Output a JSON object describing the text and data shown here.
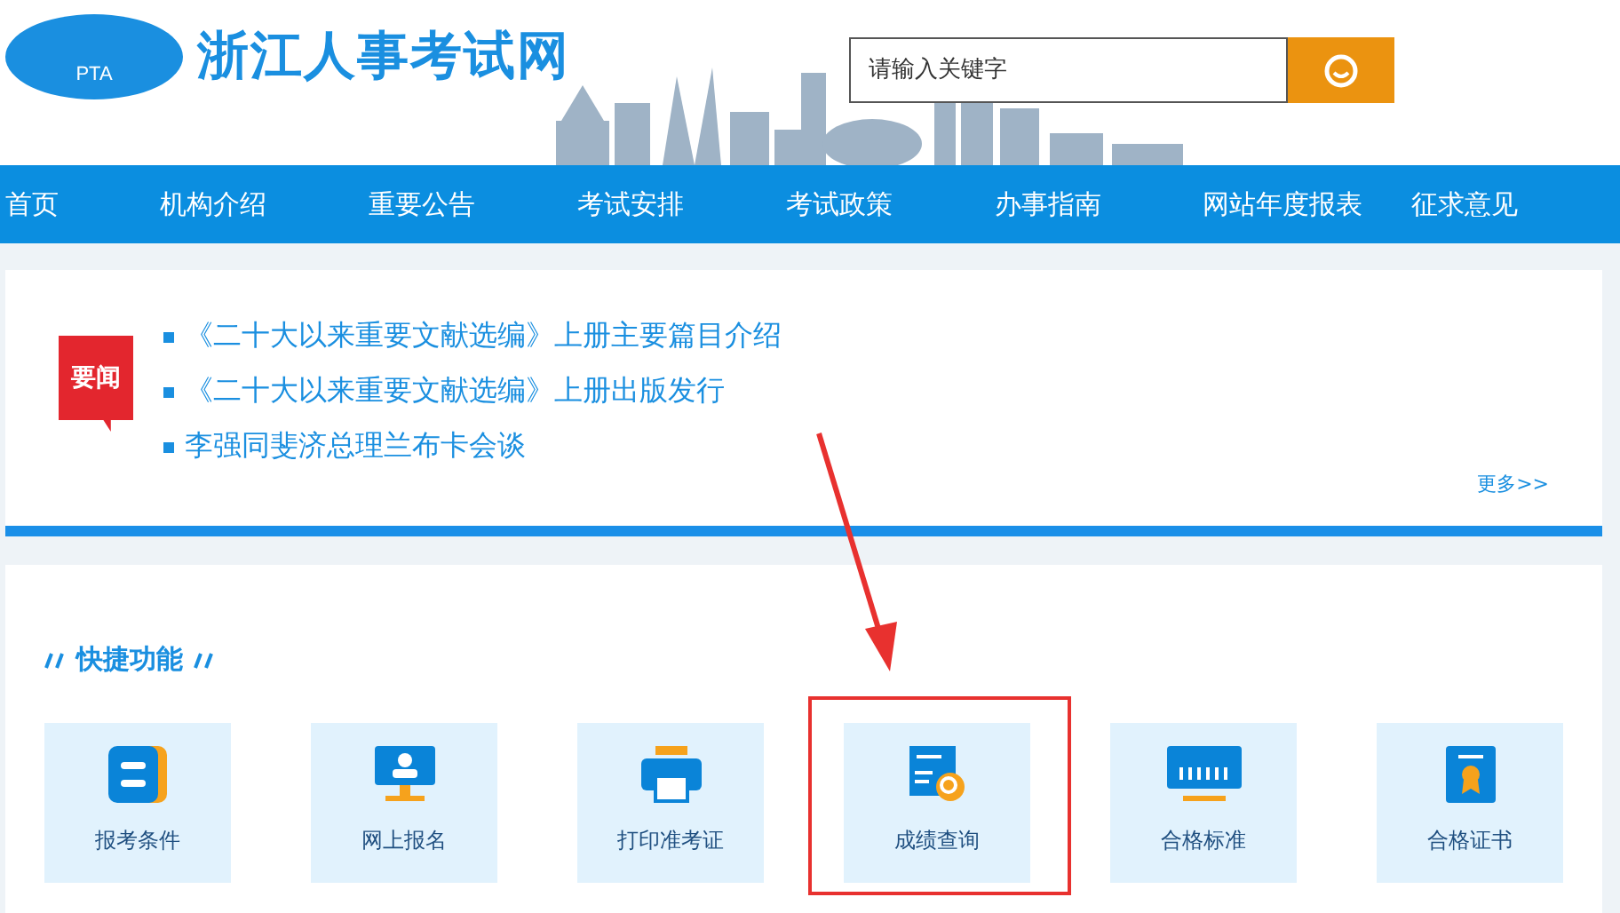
{
  "header": {
    "logo_text": "PTA",
    "site_name": "浙江人事考试网",
    "search": {
      "placeholder": "请输入关键字"
    }
  },
  "nav": [
    {
      "label": "首页"
    },
    {
      "label": "机构介绍"
    },
    {
      "label": "重要公告"
    },
    {
      "label": "考试安排"
    },
    {
      "label": "考试政策"
    },
    {
      "label": "办事指南"
    },
    {
      "label": "网站年度报表"
    },
    {
      "label": "征求意见"
    }
  ],
  "news": {
    "badge": "要闻",
    "items": [
      "《二十大以来重要文献选编》上册主要篇目介绍",
      "《二十大以来重要文献选编》上册出版发行",
      "李强同斐济总理兰布卡会谈"
    ],
    "more": "更多>>"
  },
  "quick": {
    "title": "快捷功能",
    "tiles": [
      {
        "label": "报考条件",
        "highlighted": false
      },
      {
        "label": "网上报名",
        "highlighted": false
      },
      {
        "label": "打印准考证",
        "highlighted": false
      },
      {
        "label": "成绩查询",
        "highlighted": true
      },
      {
        "label": "合格标准",
        "highlighted": false
      },
      {
        "label": "合格证书",
        "highlighted": false
      }
    ]
  }
}
